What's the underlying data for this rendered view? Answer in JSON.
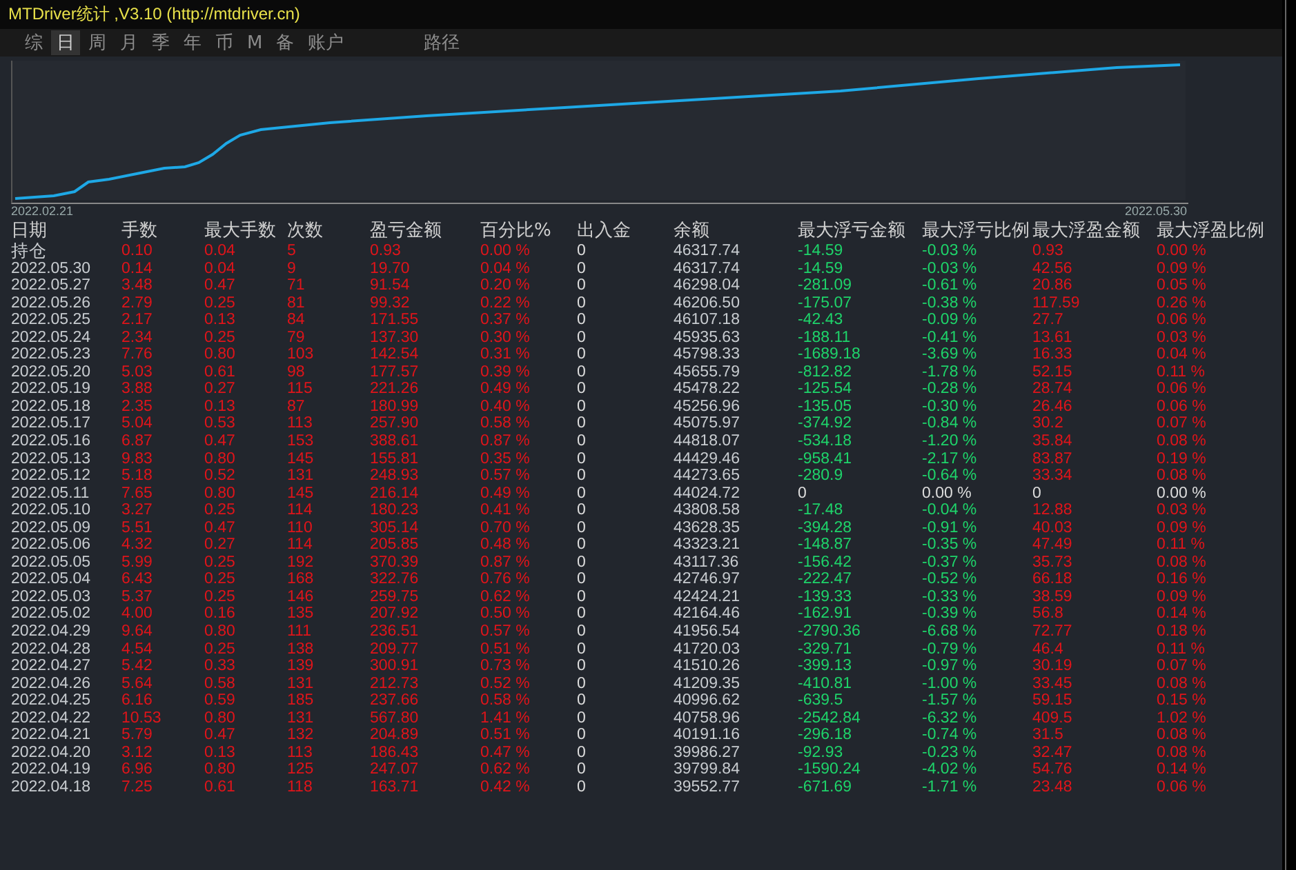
{
  "window": {
    "title": "MTDriver统计 ,V3.10 (http://mtdriver.cn)"
  },
  "tabs": [
    {
      "label": "综",
      "selected": false
    },
    {
      "label": "日",
      "selected": true
    },
    {
      "label": "周",
      "selected": false
    },
    {
      "label": "月",
      "selected": false
    },
    {
      "label": "季",
      "selected": false
    },
    {
      "label": "年",
      "selected": false
    },
    {
      "label": "币",
      "selected": false
    },
    {
      "label": "M",
      "selected": false
    },
    {
      "label": "备",
      "selected": false
    },
    {
      "label": "账户",
      "selected": false
    },
    {
      "label": "路径",
      "selected": false
    }
  ],
  "chart": {
    "start_label": "2022.02.21",
    "end_label": "2022.05.30"
  },
  "table": {
    "columns": [
      "日期",
      "手数",
      "最大手数",
      "次数",
      "盈亏金额",
      "百分比%",
      "出入金",
      "余额",
      "最大浮亏金额",
      "最大浮亏比例",
      "最大浮盈金额",
      "最大浮盈比例"
    ],
    "rows": [
      {
        "kind": "normal",
        "cells": [
          "持仓",
          "0.10",
          "0.04",
          "5",
          "0.93",
          "0.00 %",
          "0",
          "46317.74",
          "-14.59",
          "-0.03 %",
          "0.93",
          "0.00 %"
        ]
      },
      {
        "kind": "normal",
        "cells": [
          "2022.05.30",
          "0.14",
          "0.04",
          "9",
          "19.70",
          "0.04 %",
          "0",
          "46317.74",
          "-14.59",
          "-0.03 %",
          "42.56",
          "0.09 %"
        ]
      },
      {
        "kind": "normal",
        "cells": [
          "2022.05.27",
          "3.48",
          "0.47",
          "71",
          "91.54",
          "0.20 %",
          "0",
          "46298.04",
          "-281.09",
          "-0.61 %",
          "20.86",
          "0.05 %"
        ]
      },
      {
        "kind": "normal",
        "cells": [
          "2022.05.26",
          "2.79",
          "0.25",
          "81",
          "99.32",
          "0.22 %",
          "0",
          "46206.50",
          "-175.07",
          "-0.38 %",
          "117.59",
          "0.26 %"
        ]
      },
      {
        "kind": "normal",
        "cells": [
          "2022.05.25",
          "2.17",
          "0.13",
          "84",
          "171.55",
          "0.37 %",
          "0",
          "46107.18",
          "-42.43",
          "-0.09 %",
          "27.7",
          "0.06 %"
        ]
      },
      {
        "kind": "normal",
        "cells": [
          "2022.05.24",
          "2.34",
          "0.25",
          "79",
          "137.30",
          "0.30 %",
          "0",
          "45935.63",
          "-188.11",
          "-0.41 %",
          "13.61",
          "0.03 %"
        ]
      },
      {
        "kind": "normal",
        "cells": [
          "2022.05.23",
          "7.76",
          "0.80",
          "103",
          "142.54",
          "0.31 %",
          "0",
          "45798.33",
          "-1689.18",
          "-3.69 %",
          "16.33",
          "0.04 %"
        ]
      },
      {
        "kind": "normal",
        "cells": [
          "2022.05.20",
          "5.03",
          "0.61",
          "98",
          "177.57",
          "0.39 %",
          "0",
          "45655.79",
          "-812.82",
          "-1.78 %",
          "52.15",
          "0.11 %"
        ]
      },
      {
        "kind": "normal",
        "cells": [
          "2022.05.19",
          "3.88",
          "0.27",
          "115",
          "221.26",
          "0.49 %",
          "0",
          "45478.22",
          "-125.54",
          "-0.28 %",
          "28.74",
          "0.06 %"
        ]
      },
      {
        "kind": "normal",
        "cells": [
          "2022.05.18",
          "2.35",
          "0.13",
          "87",
          "180.99",
          "0.40 %",
          "0",
          "45256.96",
          "-135.05",
          "-0.30 %",
          "26.46",
          "0.06 %"
        ]
      },
      {
        "kind": "normal",
        "cells": [
          "2022.05.17",
          "5.04",
          "0.53",
          "113",
          "257.90",
          "0.58 %",
          "0",
          "45075.97",
          "-374.92",
          "-0.84 %",
          "30.2",
          "0.07 %"
        ]
      },
      {
        "kind": "normal",
        "cells": [
          "2022.05.16",
          "6.87",
          "0.47",
          "153",
          "388.61",
          "0.87 %",
          "0",
          "44818.07",
          "-534.18",
          "-1.20 %",
          "35.84",
          "0.08 %"
        ]
      },
      {
        "kind": "normal",
        "cells": [
          "2022.05.13",
          "9.83",
          "0.80",
          "145",
          "155.81",
          "0.35 %",
          "0",
          "44429.46",
          "-958.41",
          "-2.17 %",
          "83.87",
          "0.19 %"
        ]
      },
      {
        "kind": "normal",
        "cells": [
          "2022.05.12",
          "5.18",
          "0.52",
          "131",
          "248.93",
          "0.57 %",
          "0",
          "44273.65",
          "-280.9",
          "-0.64 %",
          "33.34",
          "0.08 %"
        ]
      },
      {
        "kind": "flat",
        "cells": [
          "2022.05.11",
          "7.65",
          "0.80",
          "145",
          "216.14",
          "0.49 %",
          "0",
          "44024.72",
          "0",
          "0.00 %",
          "0",
          "0.00 %"
        ]
      },
      {
        "kind": "normal",
        "cells": [
          "2022.05.10",
          "3.27",
          "0.25",
          "114",
          "180.23",
          "0.41 %",
          "0",
          "43808.58",
          "-17.48",
          "-0.04 %",
          "12.88",
          "0.03 %"
        ]
      },
      {
        "kind": "normal",
        "cells": [
          "2022.05.09",
          "5.51",
          "0.47",
          "110",
          "305.14",
          "0.70 %",
          "0",
          "43628.35",
          "-394.28",
          "-0.91 %",
          "40.03",
          "0.09 %"
        ]
      },
      {
        "kind": "normal",
        "cells": [
          "2022.05.06",
          "4.32",
          "0.27",
          "114",
          "205.85",
          "0.48 %",
          "0",
          "43323.21",
          "-148.87",
          "-0.35 %",
          "47.49",
          "0.11 %"
        ]
      },
      {
        "kind": "normal",
        "cells": [
          "2022.05.05",
          "5.99",
          "0.25",
          "192",
          "370.39",
          "0.87 %",
          "0",
          "43117.36",
          "-156.42",
          "-0.37 %",
          "35.73",
          "0.08 %"
        ]
      },
      {
        "kind": "normal",
        "cells": [
          "2022.05.04",
          "6.43",
          "0.25",
          "168",
          "322.76",
          "0.76 %",
          "0",
          "42746.97",
          "-222.47",
          "-0.52 %",
          "66.18",
          "0.16 %"
        ]
      },
      {
        "kind": "normal",
        "cells": [
          "2022.05.03",
          "5.37",
          "0.25",
          "146",
          "259.75",
          "0.62 %",
          "0",
          "42424.21",
          "-139.33",
          "-0.33 %",
          "38.59",
          "0.09 %"
        ]
      },
      {
        "kind": "normal",
        "cells": [
          "2022.05.02",
          "4.00",
          "0.16",
          "135",
          "207.92",
          "0.50 %",
          "0",
          "42164.46",
          "-162.91",
          "-0.39 %",
          "56.8",
          "0.14 %"
        ]
      },
      {
        "kind": "normal",
        "cells": [
          "2022.04.29",
          "9.64",
          "0.80",
          "111",
          "236.51",
          "0.57 %",
          "0",
          "41956.54",
          "-2790.36",
          "-6.68 %",
          "72.77",
          "0.18 %"
        ]
      },
      {
        "kind": "normal",
        "cells": [
          "2022.04.28",
          "4.54",
          "0.25",
          "138",
          "209.77",
          "0.51 %",
          "0",
          "41720.03",
          "-329.71",
          "-0.79 %",
          "46.4",
          "0.11 %"
        ]
      },
      {
        "kind": "normal",
        "cells": [
          "2022.04.27",
          "5.42",
          "0.33",
          "139",
          "300.91",
          "0.73 %",
          "0",
          "41510.26",
          "-399.13",
          "-0.97 %",
          "30.19",
          "0.07 %"
        ]
      },
      {
        "kind": "normal",
        "cells": [
          "2022.04.26",
          "5.64",
          "0.58",
          "131",
          "212.73",
          "0.52 %",
          "0",
          "41209.35",
          "-410.81",
          "-1.00 %",
          "33.45",
          "0.08 %"
        ]
      },
      {
        "kind": "normal",
        "cells": [
          "2022.04.25",
          "6.16",
          "0.59",
          "185",
          "237.66",
          "0.58 %",
          "0",
          "40996.62",
          "-639.5",
          "-1.57 %",
          "59.15",
          "0.15 %"
        ]
      },
      {
        "kind": "normal",
        "cells": [
          "2022.04.22",
          "10.53",
          "0.80",
          "131",
          "567.80",
          "1.41 %",
          "0",
          "40758.96",
          "-2542.84",
          "-6.32 %",
          "409.5",
          "1.02 %"
        ]
      },
      {
        "kind": "normal",
        "cells": [
          "2022.04.21",
          "5.79",
          "0.47",
          "132",
          "204.89",
          "0.51 %",
          "0",
          "40191.16",
          "-296.18",
          "-0.74 %",
          "31.5",
          "0.08 %"
        ]
      },
      {
        "kind": "normal",
        "cells": [
          "2022.04.20",
          "3.12",
          "0.13",
          "113",
          "186.43",
          "0.47 %",
          "0",
          "39986.27",
          "-92.93",
          "-0.23 %",
          "32.47",
          "0.08 %"
        ]
      },
      {
        "kind": "normal",
        "cells": [
          "2022.04.19",
          "6.96",
          "0.80",
          "125",
          "247.07",
          "0.62 %",
          "0",
          "39799.84",
          "-1590.24",
          "-4.02 %",
          "54.76",
          "0.14 %"
        ]
      },
      {
        "kind": "normal",
        "cells": [
          "2022.04.18",
          "7.25",
          "0.61",
          "118",
          "163.71",
          "0.42 %",
          "0",
          "39552.77",
          "-671.69",
          "-1.71 %",
          "23.48",
          "0.06 %"
        ]
      }
    ]
  }
}
